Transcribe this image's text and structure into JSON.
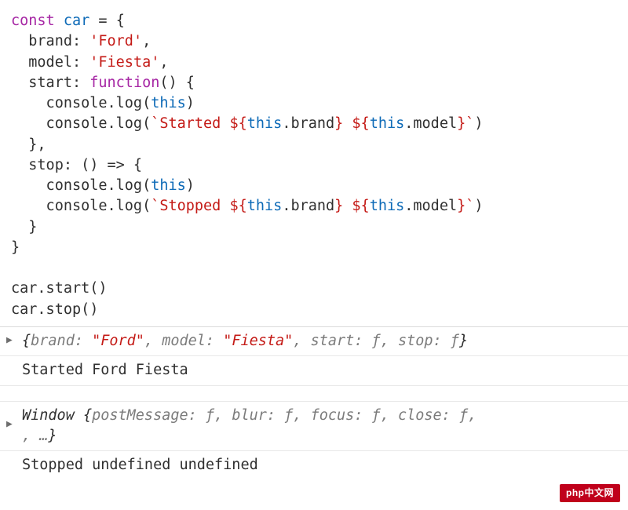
{
  "code": {
    "t_const": "const",
    "t_car": "car",
    "t_eq": " = ",
    "t_open": "{",
    "t_brand": "  brand",
    "t_colon": ": ",
    "t_brand_val": "'Ford'",
    "t_comma": ",",
    "t_model": "  model",
    "t_model_val": "'Fiesta'",
    "t_start": "  start",
    "t_function": "function",
    "t_parens_open": "() {",
    "t_console_log_this_1": "    console.log(",
    "t_this": "this",
    "t_close_paren": ")",
    "t_console_log_2": "    console.log(",
    "t_tick": "`",
    "t_started_pre": "Started ",
    "t_interp_open": "${",
    "t_interp_this": "this",
    "t_interp_brand": ".brand",
    "t_interp_close": "}",
    "t_space": " ",
    "t_interp_model": ".model",
    "t_line_close_brace": "  }",
    "t_stop": "  stop",
    "t_arrow": "() => {",
    "t_console_log_this_3": "    console.log(",
    "t_console_log_4": "    console.log(",
    "t_stopped_pre": "Stopped ",
    "t_line_close_brace2": "  }",
    "t_close_obj": "}",
    "t_call_start": "car.start()",
    "t_call_stop": "car.stop()"
  },
  "console": {
    "row1": {
      "open": "{",
      "brand_k": "brand: ",
      "brand_v": "\"Ford\"",
      "sep1": ", ",
      "model_k": "model: ",
      "model_v": "\"Fiesta\"",
      "sep2": ", ",
      "start_k": "start: ",
      "start_v": "ƒ",
      "sep3": ", ",
      "stop_k": "stop: ",
      "stop_v": "ƒ",
      "close": "}"
    },
    "row2": "Started Ford Fiesta",
    "row3": {
      "name": "Window ",
      "open": "{",
      "pm_k": "postMessage: ",
      "pm_v": "ƒ",
      "sep1": ", ",
      "blur_k": "blur: ",
      "blur_v": "ƒ",
      "sep2": ", ",
      "focus_k": "focus: ",
      "focus_v": "ƒ",
      "sep3": ", ",
      "close_k": "close: ",
      "close_v": "ƒ",
      "sep4": ", ",
      "ell": ", …",
      "close": "}"
    },
    "row4": "Stopped undefined undefined"
  },
  "logo_text": "php中文网"
}
